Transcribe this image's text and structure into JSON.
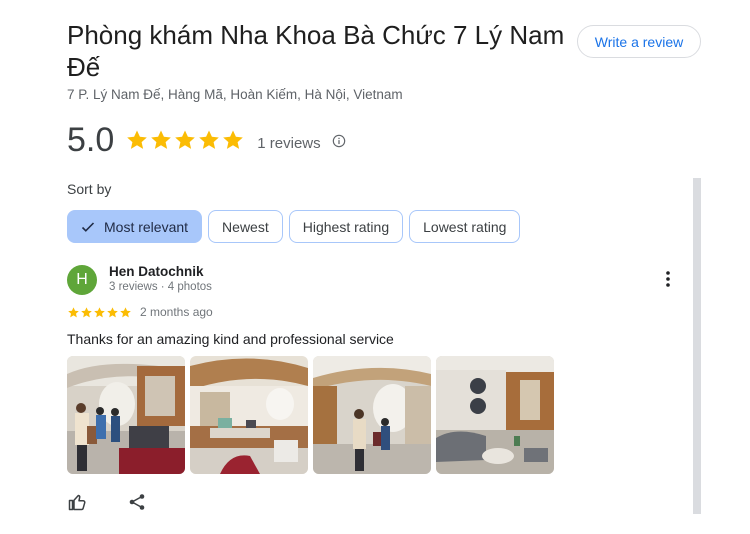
{
  "place": {
    "name": "Phòng khám Nha Khoa Bà Chức 7 Lý Nam Đế",
    "address": "7 P. Lý Nam Đế, Hàng Mã, Hoàn Kiếm, Hà Nội, Vietnam"
  },
  "write_review_label": "Write a review",
  "rating": {
    "value": "5.0",
    "stars": 5,
    "count_label": "1 reviews",
    "star_color": "#fbbc04"
  },
  "sort": {
    "label": "Sort by",
    "options": [
      {
        "label": "Most relevant",
        "selected": true
      },
      {
        "label": "Newest",
        "selected": false
      },
      {
        "label": "Highest rating",
        "selected": false
      },
      {
        "label": "Lowest rating",
        "selected": false
      }
    ]
  },
  "review": {
    "avatar_initial": "H",
    "avatar_color": "#5fa639",
    "author": "Hen Datochnik",
    "author_meta": "3 reviews · 4 photos",
    "stars": 5,
    "time": "2 months ago",
    "text": "Thanks for an amazing kind and professional service",
    "photo_count": 4
  },
  "icons": {
    "check": "check-icon",
    "info": "info-icon",
    "more": "more-vert-icon",
    "like": "thumb-up-icon",
    "share": "share-icon"
  }
}
